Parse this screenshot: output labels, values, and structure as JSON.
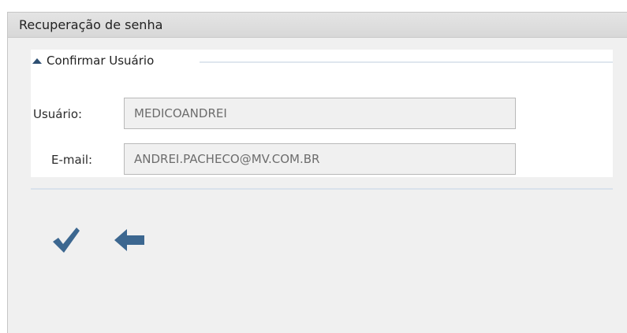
{
  "window": {
    "title": "Recuperação de senha"
  },
  "section": {
    "title": "Confirmar Usuário",
    "expanded": true,
    "toggle_icon": "chevron-up-icon"
  },
  "fields": {
    "usuario": {
      "label": "Usuário:",
      "value": "MEDICOANDREI",
      "readonly": true
    },
    "email": {
      "label": "E-mail:",
      "value": "ANDREI.PACHECO@MV.COM.BR",
      "readonly": true
    }
  },
  "actions": {
    "confirm_icon": "checkmark-icon",
    "back_icon": "arrow-left-icon",
    "icon_color": "#3c6790"
  },
  "colors": {
    "titlebar_bg": "#dddddd",
    "window_bg": "#f0f0f0",
    "accent": "#2e4f72"
  }
}
